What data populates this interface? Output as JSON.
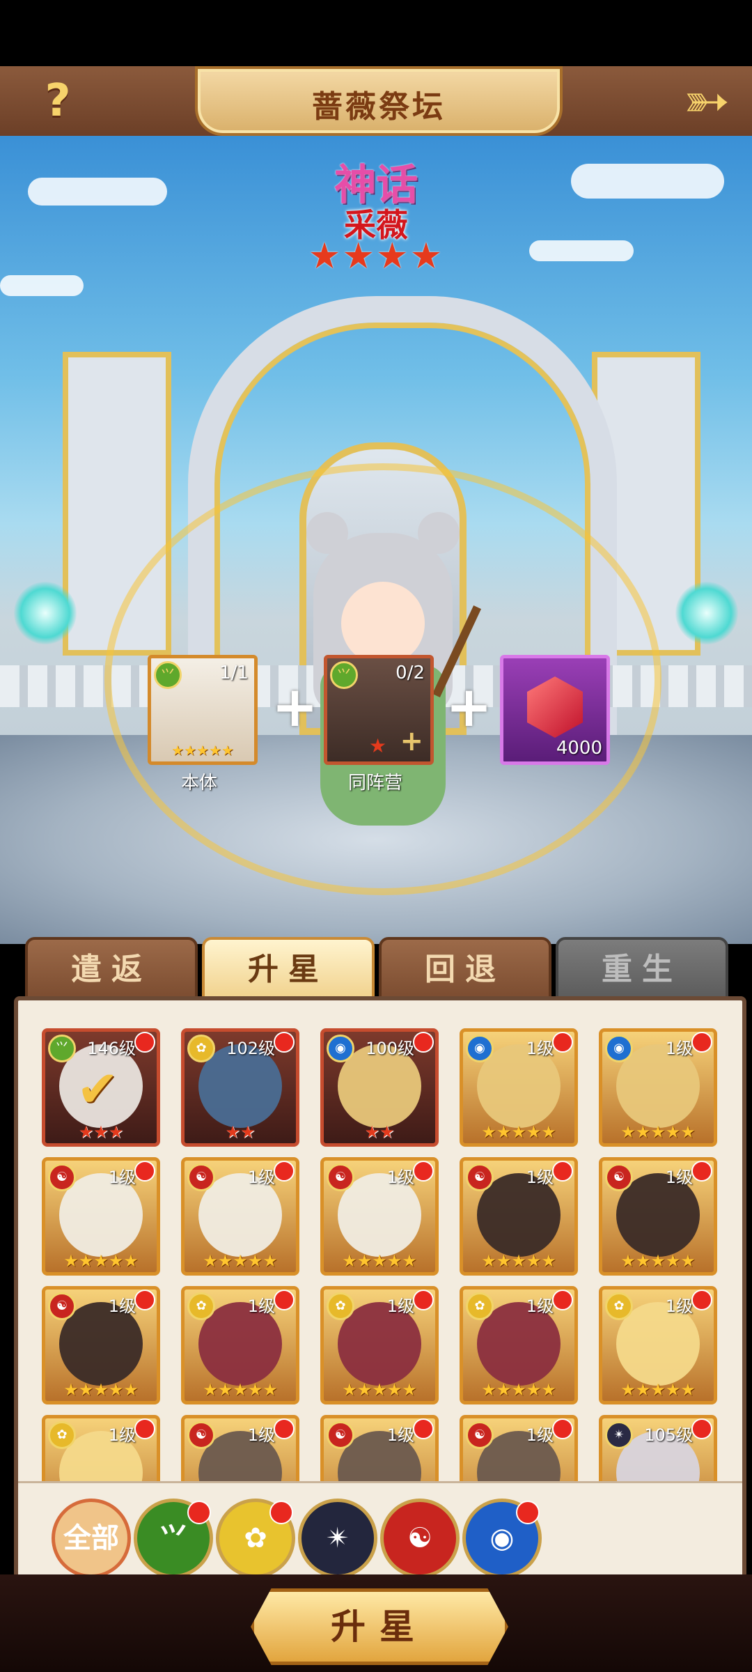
{
  "header": {
    "help_icon": "?",
    "title": "蔷薇祭坛",
    "back_icon": "➳"
  },
  "hero": {
    "rarity_label": "神话",
    "name": "采薇",
    "stars": "★★★★"
  },
  "materials": {
    "self": {
      "count": "1/1",
      "stars": "★★★★★",
      "label": "本体"
    },
    "camp": {
      "count": "0/2",
      "star": "★",
      "plus_icon": "+",
      "label": "同阵营"
    },
    "gem": {
      "count": "4000"
    }
  },
  "plus_sign": "+",
  "tabs": [
    "遣返",
    "升星",
    "回退",
    "重生"
  ],
  "cards": [
    {
      "level": "146级",
      "stars": "★★★",
      "fac": "wood",
      "red": true,
      "checked": true
    },
    {
      "level": "102级",
      "stars": "★★",
      "fac": "light",
      "red": true
    },
    {
      "level": "100级",
      "stars": "★★",
      "fac": "water",
      "red": true
    },
    {
      "level": "1级",
      "stars": "★★★★★",
      "fac": "water"
    },
    {
      "level": "1级",
      "stars": "★★★★★",
      "fac": "water"
    },
    {
      "level": "1级",
      "stars": "★★★★★",
      "fac": "fire"
    },
    {
      "level": "1级",
      "stars": "★★★★★",
      "fac": "fire"
    },
    {
      "level": "1级",
      "stars": "★★★★★",
      "fac": "fire"
    },
    {
      "level": "1级",
      "stars": "★★★★★",
      "fac": "fire"
    },
    {
      "level": "1级",
      "stars": "★★★★★",
      "fac": "fire"
    },
    {
      "level": "1级",
      "stars": "★★★★★",
      "fac": "fire"
    },
    {
      "level": "1级",
      "stars": "★★★★★",
      "fac": "light"
    },
    {
      "level": "1级",
      "stars": "★★★★★",
      "fac": "light"
    },
    {
      "level": "1级",
      "stars": "★★★★★",
      "fac": "light"
    },
    {
      "level": "1级",
      "stars": "★★★★★",
      "fac": "light"
    },
    {
      "level": "1级",
      "stars": "",
      "fac": "light"
    },
    {
      "level": "1级",
      "stars": "",
      "fac": "fire"
    },
    {
      "level": "1级",
      "stars": "",
      "fac": "fire"
    },
    {
      "level": "1级",
      "stars": "",
      "fac": "fire"
    },
    {
      "level": "105级",
      "stars": "",
      "fac": "dark"
    }
  ],
  "filters": {
    "all": "全部",
    "icons": [
      "wood-icon",
      "light-icon",
      "dark-icon",
      "fire-icon",
      "water-icon"
    ]
  },
  "main_button": "升星",
  "colors": {
    "wood": "#5fa82c",
    "light": "#e7b92a",
    "water": "#1f6fd1",
    "fire": "#c8251f",
    "dark": "#2a2a44"
  }
}
